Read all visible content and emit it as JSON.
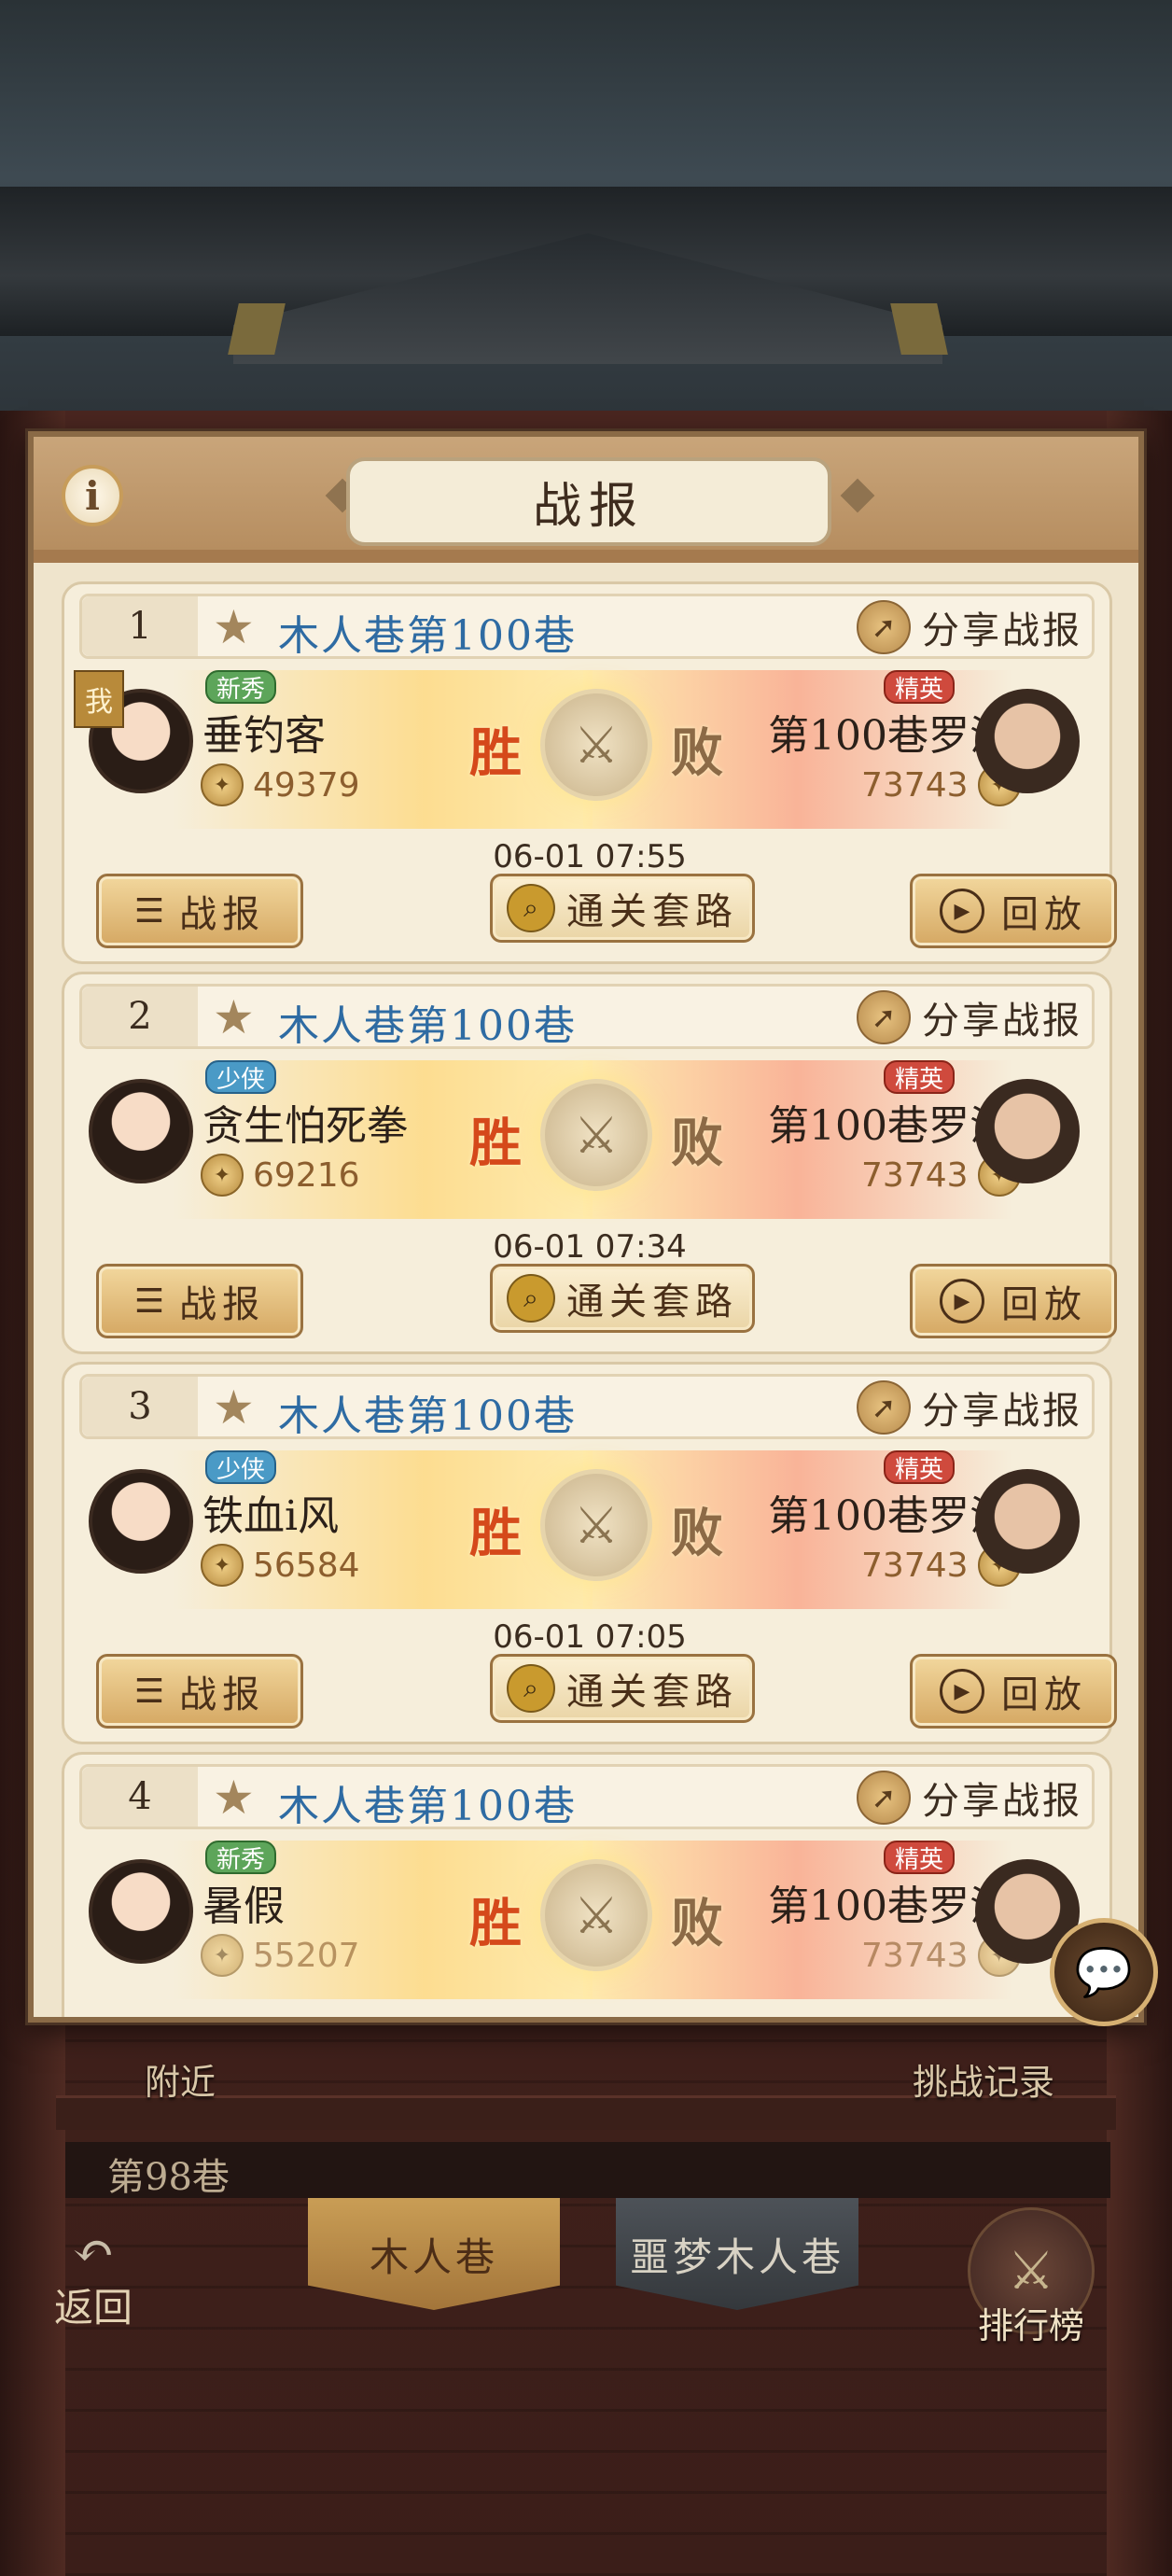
{
  "dialog": {
    "title": "战报",
    "info_icon": "info-icon"
  },
  "reports": [
    {
      "rank": "1",
      "level": "木人巷第100巷",
      "share": "分享战报",
      "is_me": true,
      "me_badge": "我",
      "player": {
        "tag": "新秀",
        "tag_color": "green",
        "name": "垂钓客",
        "power": "49379"
      },
      "result_win": "胜",
      "result_lose": "败",
      "opponent": {
        "tag": "精英",
        "name": "第100巷罗汉",
        "power": "73743"
      },
      "time": "06-01 07:55",
      "buttons": {
        "report": "战报",
        "guide": "通关套路",
        "replay": "回放"
      }
    },
    {
      "rank": "2",
      "level": "木人巷第100巷",
      "share": "分享战报",
      "is_me": false,
      "player": {
        "tag": "少侠",
        "tag_color": "blue",
        "name": "贪生怕死拳",
        "power": "69216"
      },
      "result_win": "胜",
      "result_lose": "败",
      "opponent": {
        "tag": "精英",
        "name": "第100巷罗汉",
        "power": "73743"
      },
      "time": "06-01 07:34",
      "buttons": {
        "report": "战报",
        "guide": "通关套路",
        "replay": "回放"
      }
    },
    {
      "rank": "3",
      "level": "木人巷第100巷",
      "share": "分享战报",
      "is_me": false,
      "player": {
        "tag": "少侠",
        "tag_color": "blue",
        "name": "铁血i风",
        "power": "56584"
      },
      "result_win": "胜",
      "result_lose": "败",
      "opponent": {
        "tag": "精英",
        "name": "第100巷罗汉",
        "power": "73743"
      },
      "time": "06-01 07:05",
      "buttons": {
        "report": "战报",
        "guide": "通关套路",
        "replay": "回放"
      }
    },
    {
      "rank": "4",
      "level": "木人巷第100巷",
      "share": "分享战报",
      "is_me": false,
      "player": {
        "tag": "新秀",
        "tag_color": "green",
        "name": "暑假",
        "power": "55207"
      },
      "result_win": "胜",
      "result_lose": "败",
      "opponent": {
        "tag": "精英",
        "name": "第100巷罗汉",
        "power": "73743"
      }
    }
  ],
  "background": {
    "nearby": "附近",
    "challenge_record": "挑战记录",
    "current_scroll": "第98巷",
    "tab_active": "木人巷",
    "tab_inactive": "噩梦木人巷",
    "back": "返回",
    "leaderboard": "排行榜"
  },
  "colors": {
    "level_title": "#2e6ba3",
    "win": "#d5491b",
    "tag_green": "#5da55a",
    "tag_blue": "#4a9ac6",
    "tag_red": "#cf4a3d"
  }
}
